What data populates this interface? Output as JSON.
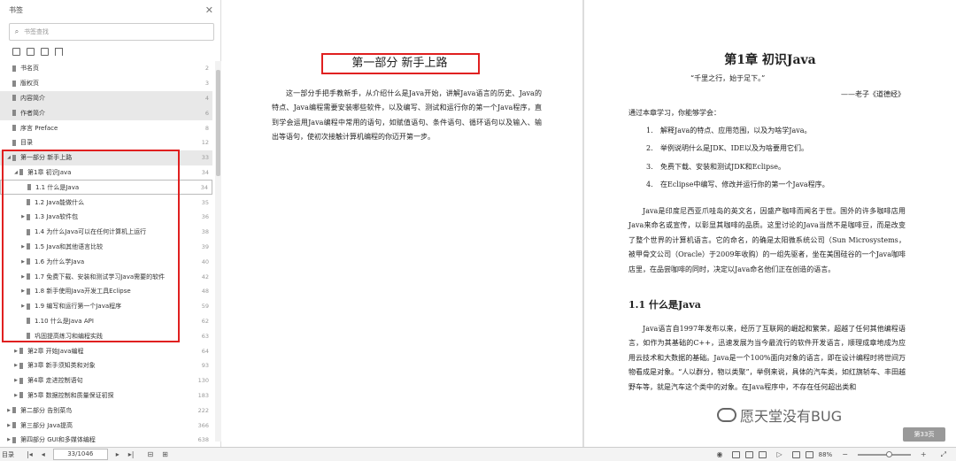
{
  "sidebar": {
    "title": "书签",
    "search_placeholder": "书签查找",
    "toc": [
      {
        "label": "书名页",
        "page": "2",
        "level": 0,
        "arrow": "",
        "state": ""
      },
      {
        "label": "版权页",
        "page": "3",
        "level": 0,
        "arrow": "",
        "state": ""
      },
      {
        "label": "内容简介",
        "page": "4",
        "level": 0,
        "arrow": "",
        "state": "sel"
      },
      {
        "label": "作者简介",
        "page": "6",
        "level": 0,
        "arrow": "",
        "state": "sel"
      },
      {
        "label": "序言  Preface",
        "page": "8",
        "level": 0,
        "arrow": "",
        "state": ""
      },
      {
        "label": "目录",
        "page": "12",
        "level": 0,
        "arrow": "",
        "state": ""
      },
      {
        "label": "第一部分  新手上路",
        "page": "33",
        "level": 0,
        "arrow": "◢",
        "state": "sel"
      },
      {
        "label": "第1章  初识Java",
        "page": "34",
        "level": 1,
        "arrow": "◢",
        "state": ""
      },
      {
        "label": "1.1  什么是Java",
        "page": "34",
        "level": 2,
        "arrow": "",
        "state": "cur"
      },
      {
        "label": "1.2  Java能做什么",
        "page": "35",
        "level": 2,
        "arrow": "",
        "state": ""
      },
      {
        "label": "1.3  Java软件包",
        "page": "36",
        "level": 2,
        "arrow": "▶",
        "state": ""
      },
      {
        "label": "1.4  为什么Java可以在任何计算机上运行",
        "page": "38",
        "level": 2,
        "arrow": "",
        "state": ""
      },
      {
        "label": "1.5  Java和其他语言比较",
        "page": "39",
        "level": 2,
        "arrow": "▶",
        "state": ""
      },
      {
        "label": "1.6  为什么学Java",
        "page": "40",
        "level": 2,
        "arrow": "▶",
        "state": ""
      },
      {
        "label": "1.7  免费下载、安装和测试学习Java需要的软件",
        "page": "42",
        "level": 2,
        "arrow": "▶",
        "state": ""
      },
      {
        "label": "1.8  新手使用Java开发工具Eclipse",
        "page": "48",
        "level": 2,
        "arrow": "▶",
        "state": ""
      },
      {
        "label": "1.9  编写和运行第一个Java程序",
        "page": "59",
        "level": 2,
        "arrow": "▶",
        "state": ""
      },
      {
        "label": "1.10  什么是Java API",
        "page": "62",
        "level": 2,
        "arrow": "",
        "state": ""
      },
      {
        "label": "巩固提高练习和编程实践",
        "page": "63",
        "level": 2,
        "arrow": "",
        "state": ""
      },
      {
        "label": "第2章  开始Java编程",
        "page": "64",
        "level": 1,
        "arrow": "▶",
        "state": ""
      },
      {
        "label": "第3章  新手须知类和对象",
        "page": "93",
        "level": 1,
        "arrow": "▶",
        "state": ""
      },
      {
        "label": "第4章  走进控制语句",
        "page": "130",
        "level": 1,
        "arrow": "▶",
        "state": ""
      },
      {
        "label": "第5章  数据控制和质量保证初探",
        "page": "183",
        "level": 1,
        "arrow": "▶",
        "state": ""
      },
      {
        "label": "第二部分  告别菜鸟",
        "page": "222",
        "level": 0,
        "arrow": "▶",
        "state": ""
      },
      {
        "label": "第三部分  Java提高",
        "page": "366",
        "level": 0,
        "arrow": "▶",
        "state": ""
      },
      {
        "label": "第四部分  GUI和多媒体编程",
        "page": "638",
        "level": 0,
        "arrow": "▶",
        "state": ""
      }
    ]
  },
  "left_page": {
    "part_title": "第一部分    新手上路",
    "intro": "这一部分手把手教新手，从介绍什么是Java开始，讲解Java语言的历史、Java的特点、Java编程需要安装哪些软件，以及编写、测试和运行你的第一个Java程序，直到学会运用Java编程中常用的语句，如赋值语句、条件语句、循环语句以及输入、输出等语句，使初次接触计算机编程的你迈开第一步。"
  },
  "right_page": {
    "chapter_title": "第1章    初识Java",
    "quote": "“千里之行，始于足下。”",
    "quote_author": "——老子《道德经》",
    "goals_intro": "通过本章学习，你能够学会：",
    "goals": [
      {
        "num": "1.",
        "text": "解释Java的特点、应用范围，以及为啥学Java。"
      },
      {
        "num": "2.",
        "text": "举例说明什么是JDK、IDE以及为啥要用它们。"
      },
      {
        "num": "3.",
        "text": "免费下载、安装和测试JDK和Eclipse。"
      },
      {
        "num": "4.",
        "text": "在Eclipse中编写、修改并运行你的第一个Java程序。"
      }
    ],
    "para1": "Java是印度尼西亚爪哇岛的英文名，因盛产咖啡而闻名于世。国外的许多咖啡店用Java来命名或宣传，以彰显其咖啡的品质。这里讨论的Java当然不是咖啡豆，而是改变了整个世界的计算机语言。它的命名，的确是太阳微系统公司（Sun Microsystems，被甲骨文公司（Oracle）于2009年收购）的一组先驱者，坐在美国硅谷的一个Java咖啡店里，在品尝咖啡的同时，决定以Java命名他们正在创造的语言。",
    "section_title": "1.1    什么是Java",
    "para2": "Java语言自1997年发布以来，经历了互联网的崛起和繁荣，超越了任何其他编程语言，如作为其基础的C++，迅速发展为当今最流行的软件开发语言，顺理成章地成为应用云技术和大数据的基础。Java是一个100%面向对象的语言，即在设计编程时将世间万物看成是对象。“人以群分，物以类聚”，举例来说，具体的汽车类，如红旗轿车、丰田越野车等，就是汽车这个类中的对象。在Java程序中，不存在任何超出类和"
  },
  "watermark": "愿天堂没有BUG",
  "page_badge": "第33页",
  "statusbar": {
    "page_indicator": "33/1046",
    "zoom": "88%",
    "left_label": "目录"
  }
}
